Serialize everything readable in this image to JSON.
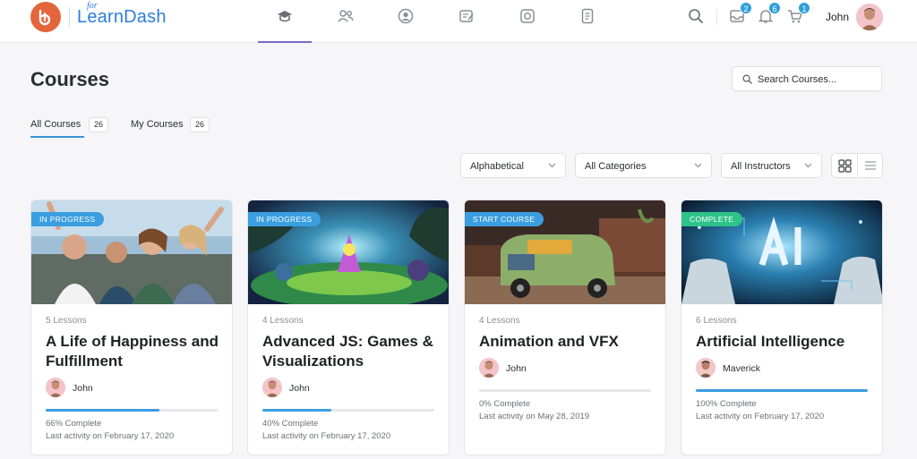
{
  "header": {
    "logo_small": "for",
    "logo_text": "LearnDash",
    "nav_icons": [
      "graduation-cap-icon",
      "users-icon",
      "profile-icon",
      "edit-note-icon",
      "photo-icon",
      "document-icon"
    ],
    "search_icon": "search-icon",
    "inbox_badge": "2",
    "notifications_badge": "6",
    "cart_badge": "1",
    "user_name": "John"
  },
  "page": {
    "title": "Courses",
    "search_placeholder": "Search Courses..."
  },
  "tabs": [
    {
      "label": "All Courses",
      "count": "26",
      "active": true
    },
    {
      "label": "My Courses",
      "count": "26",
      "active": false
    }
  ],
  "filters": {
    "order": "Alphabetical",
    "category": "All Categories",
    "instructor": "All Instructors"
  },
  "colors": {
    "in_progress": "#3a9ee0",
    "start_course": "#3a9ee0",
    "complete": "#2fc28a",
    "brand": "#2b7ddb",
    "logo": "#e3653b"
  },
  "courses": [
    {
      "status": "In Progress",
      "lessons": "5 Lessons",
      "title": "A Life of Happiness and Fulfillment",
      "author": "John",
      "progress": 0.66,
      "progress_label": "66% Complete",
      "last_activity": "Last activity on February 17, 2020"
    },
    {
      "status": "In Progress",
      "lessons": "4 Lessons",
      "title": "Advanced JS: Games & Visualizations",
      "author": "John",
      "progress": 0.4,
      "progress_label": "40% Complete",
      "last_activity": "Last activity on February 17, 2020"
    },
    {
      "status": "Start Course",
      "lessons": "4 Lessons",
      "title": "Animation and VFX",
      "author": "John",
      "progress": 0.0,
      "progress_label": "0% Complete",
      "last_activity": "Last activity on May 28, 2019"
    },
    {
      "status": "Complete",
      "lessons": "6 Lessons",
      "title": "Artificial Intelligence",
      "author": "Maverick",
      "progress": 1.0,
      "progress_label": "100% Complete",
      "last_activity": "Last activity on February 17, 2020"
    }
  ]
}
